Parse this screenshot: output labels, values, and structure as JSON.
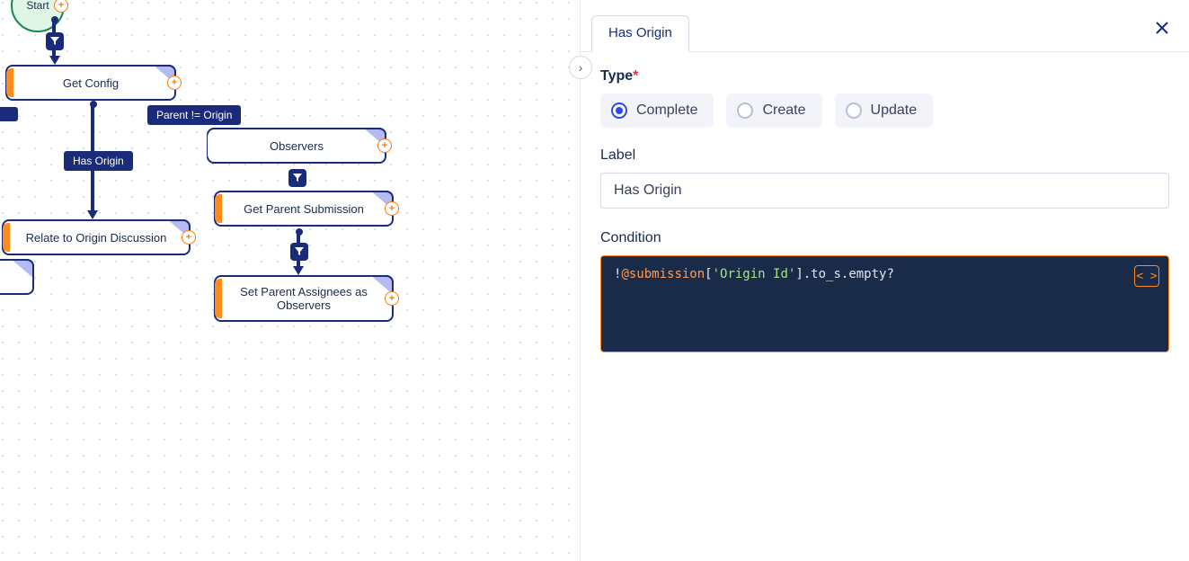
{
  "canvas": {
    "start_label": "Start",
    "nodes": {
      "get_config": "Get Config",
      "observers": "Observers",
      "get_parent_submission": "Get Parent Submission",
      "relate_origin": "Relate to Origin Discussion",
      "set_parent_assignees": "Set Parent Assignees as Observers"
    },
    "connectors": {
      "has_origin": "Has Origin",
      "parent_not_origin": "Parent != Origin"
    }
  },
  "panel": {
    "tab_title": "Has Origin",
    "type_label": "Type",
    "type_options": {
      "complete": "Complete",
      "create": "Create",
      "update": "Update"
    },
    "type_selected": "complete",
    "label_label": "Label",
    "label_value": "Has Origin",
    "condition_label": "Condition",
    "condition_code_plain": "!@submission['Origin Id'].to_s.empty?",
    "condition_code_parts": {
      "p1": "!",
      "p2": "@submission",
      "p3": "[",
      "p4": "'Origin Id'",
      "p5": "].to_s.empty?"
    }
  }
}
